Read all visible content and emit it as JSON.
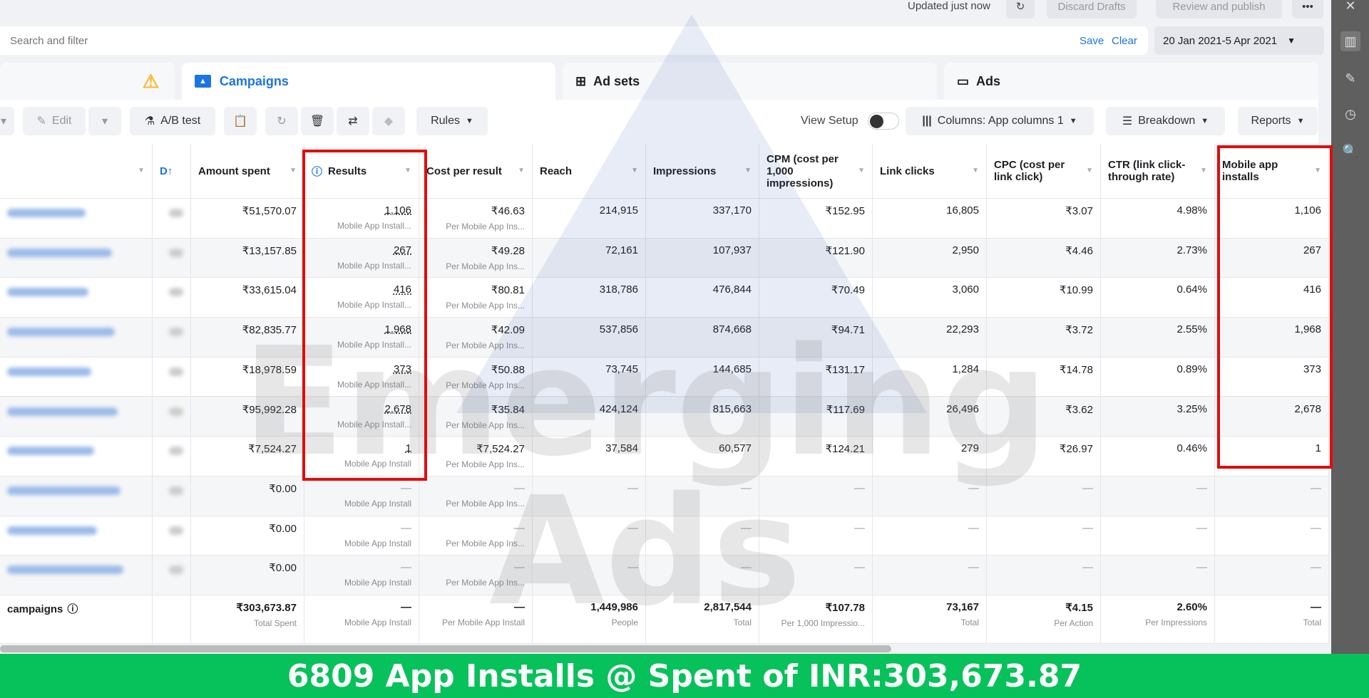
{
  "topbar": {
    "updated": "Updated just now",
    "discard": "Discard Drafts",
    "review": "Review and publish",
    "more": "•••",
    "close": "✕"
  },
  "search": {
    "placeholder": "Search and filter",
    "save": "Save",
    "clear": "Clear",
    "date_range": "20 Jan 2021-5 Apr 2021"
  },
  "tabs": [
    {
      "label": "Campaigns"
    },
    {
      "label": "Ad sets"
    },
    {
      "label": "Ads"
    }
  ],
  "toolbar": {
    "edit": "Edit",
    "ab_test": "A/B test",
    "rules": "Rules",
    "view_setup": "View Setup",
    "columns": "Columns: App columns 1",
    "breakdown": "Breakdown",
    "reports": "Reports"
  },
  "columns": [
    "D",
    "Amount spent",
    "Results",
    "Cost per result",
    "Reach",
    "Impressions",
    "CPM (cost per 1,000 impressions)",
    "Link clicks",
    "CPC (cost per link click)",
    "CTR (link click-through rate)",
    "Mobile app installs"
  ],
  "rows": [
    {
      "amount": "₹51,570.07",
      "results": "1,106",
      "results_sub": "Mobile App Install...",
      "cpr": "₹46.63",
      "cpr_sub": "Per Mobile App Ins...",
      "reach": "214,915",
      "impr": "337,170",
      "cpm": "₹152.95",
      "clicks": "16,805",
      "cpc": "₹3.07",
      "ctr": "4.98%",
      "installs": "1,106"
    },
    {
      "amount": "₹13,157.85",
      "results": "267",
      "results_sub": "Mobile App Install...",
      "cpr": "₹49.28",
      "cpr_sub": "Per Mobile App Ins...",
      "reach": "72,161",
      "impr": "107,937",
      "cpm": "₹121.90",
      "clicks": "2,950",
      "cpc": "₹4.46",
      "ctr": "2.73%",
      "installs": "267"
    },
    {
      "amount": "₹33,615.04",
      "results": "416",
      "results_sub": "Mobile App Install...",
      "cpr": "₹80.81",
      "cpr_sub": "Per Mobile App Ins...",
      "reach": "318,786",
      "impr": "476,844",
      "cpm": "₹70.49",
      "clicks": "3,060",
      "cpc": "₹10.99",
      "ctr": "0.64%",
      "installs": "416"
    },
    {
      "amount": "₹82,835.77",
      "results": "1,968",
      "results_sub": "Mobile App Install...",
      "cpr": "₹42.09",
      "cpr_sub": "Per Mobile App Ins...",
      "reach": "537,856",
      "impr": "874,668",
      "cpm": "₹94.71",
      "clicks": "22,293",
      "cpc": "₹3.72",
      "ctr": "2.55%",
      "installs": "1,968"
    },
    {
      "amount": "₹18,978.59",
      "results": "373",
      "results_sub": "Mobile App Install...",
      "cpr": "₹50.88",
      "cpr_sub": "Per Mobile App Ins...",
      "reach": "73,745",
      "impr": "144,685",
      "cpm": "₹131.17",
      "clicks": "1,284",
      "cpc": "₹14.78",
      "ctr": "0.89%",
      "installs": "373"
    },
    {
      "amount": "₹95,992.28",
      "results": "2,678",
      "results_sub": "Mobile App Install...",
      "cpr": "₹35.84",
      "cpr_sub": "Per Mobile App Ins...",
      "reach": "424,124",
      "impr": "815,663",
      "cpm": "₹117.69",
      "clicks": "26,496",
      "cpc": "₹3.62",
      "ctr": "3.25%",
      "installs": "2,678"
    },
    {
      "amount": "₹7,524.27",
      "results": "1",
      "results_sub": "Mobile App Install",
      "cpr": "₹7,524.27",
      "cpr_sub": "Per Mobile App Ins...",
      "reach": "37,584",
      "impr": "60,577",
      "cpm": "₹124.21",
      "clicks": "279",
      "cpc": "₹26.97",
      "ctr": "0.46%",
      "installs": "1"
    },
    {
      "amount": "₹0.00",
      "results": "—",
      "results_sub": "Mobile App Install",
      "cpr": "—",
      "cpr_sub": "Per Mobile App Ins...",
      "reach": "—",
      "impr": "—",
      "cpm": "—",
      "clicks": "—",
      "cpc": "—",
      "ctr": "—",
      "installs": "—"
    },
    {
      "amount": "₹0.00",
      "results": "—",
      "results_sub": "Mobile App Install",
      "cpr": "—",
      "cpr_sub": "Per Mobile App Ins...",
      "reach": "—",
      "impr": "—",
      "cpm": "—",
      "clicks": "—",
      "cpc": "—",
      "ctr": "—",
      "installs": "—"
    },
    {
      "amount": "₹0.00",
      "results": "—",
      "results_sub": "Mobile App Install",
      "cpr": "—",
      "cpr_sub": "Per Mobile App Ins...",
      "reach": "—",
      "impr": "—",
      "cpm": "—",
      "clicks": "—",
      "cpc": "—",
      "ctr": "—",
      "installs": "—"
    }
  ],
  "totals": {
    "label": "campaigns",
    "amount": "₹303,673.87",
    "amount_sub": "Total Spent",
    "results": "—",
    "results_sub": "Mobile App Install",
    "cpr": "—",
    "cpr_sub": "Per Mobile App Install",
    "reach": "1,449,986",
    "reach_sub": "People",
    "impr": "2,817,544",
    "impr_sub": "Total",
    "cpm": "₹107.78",
    "cpm_sub": "Per 1,000 Impressio...",
    "clicks": "73,167",
    "clicks_sub": "Total",
    "cpc": "₹4.15",
    "cpc_sub": "Per Action",
    "ctr": "2.60%",
    "ctr_sub": "Per Impressions",
    "installs": "—",
    "installs_sub": "Total"
  },
  "banner": "6809 App Installs @ Spent of INR:303,673.87",
  "watermark": "Emerging Ads",
  "colors": {
    "accent": "#1b74e4",
    "highlight": "#e30b0b",
    "banner": "#07c15a"
  }
}
